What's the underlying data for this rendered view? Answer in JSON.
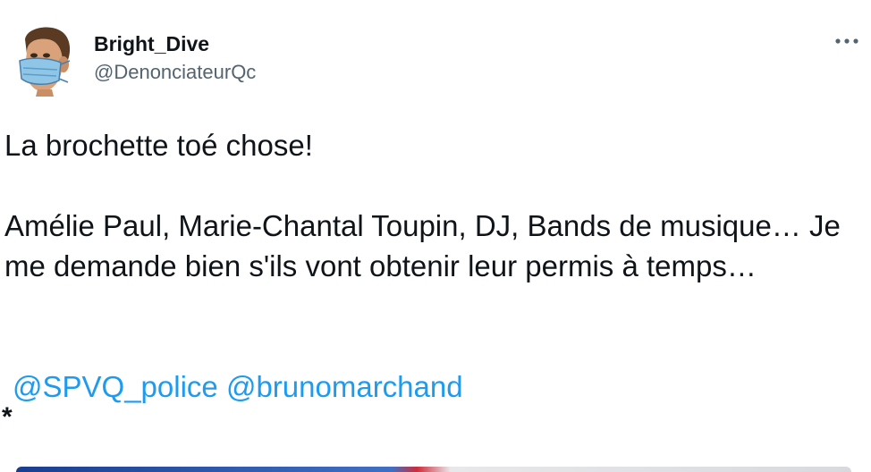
{
  "author": {
    "display_name": "Bright_Dive",
    "handle": "@DenonciateurQc",
    "avatar_icon": "masked-face-avatar"
  },
  "menu": {
    "more_icon": "more-horizontal-icon"
  },
  "tweet": {
    "line1": "La brochette toé chose!",
    "line2": "Amélie Paul, Marie-Chantal Toupin, DJ, Bands de musique… Je me demande bien s'ils vont obtenir leur permis à temps…",
    "mentions": [
      "@SPVQ_police",
      "@bruno​marchand"
    ],
    "asterisk": "*"
  },
  "colors": {
    "text": "#0f1419",
    "secondary": "#536471",
    "link": "#1d9bf0"
  }
}
